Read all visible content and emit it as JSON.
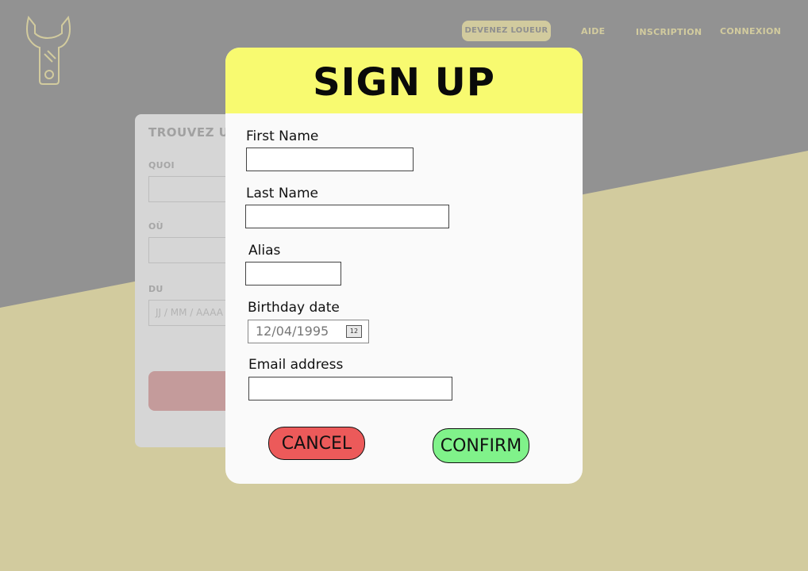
{
  "nav": {
    "become_renter": "DEVENEZ LOUEUR",
    "help": "AIDE",
    "signup": "INSCRIPTION",
    "login": "CONNEXION"
  },
  "search_card": {
    "title": "TROUVEZ UN",
    "what_label": "QUOI",
    "where_label": "OÙ",
    "from_label": "DU",
    "from_placeholder": "JJ / MM / AAAA"
  },
  "modal": {
    "title": "SIGN UP",
    "first_name_label": "First Name",
    "first_name_value": "",
    "last_name_label": "Last Name",
    "last_name_value": "",
    "alias_label": "Alias",
    "alias_value": "",
    "birthday_label": "Birthday date",
    "birthday_value": "12/04/1995",
    "calendar_icon_text": "12",
    "email_label": "Email address",
    "email_value": "",
    "cancel_label": "CANCEL",
    "confirm_label": "CONFIRM"
  },
  "colors": {
    "background_tan": "#d2cb9e",
    "background_gray": "#929292",
    "header_yellow": "#f8fa70",
    "cancel_red": "#ec5a5a",
    "confirm_green": "#80f28a"
  },
  "icons": {
    "logo": "wrench-logo-icon",
    "calendar": "calendar-icon"
  }
}
